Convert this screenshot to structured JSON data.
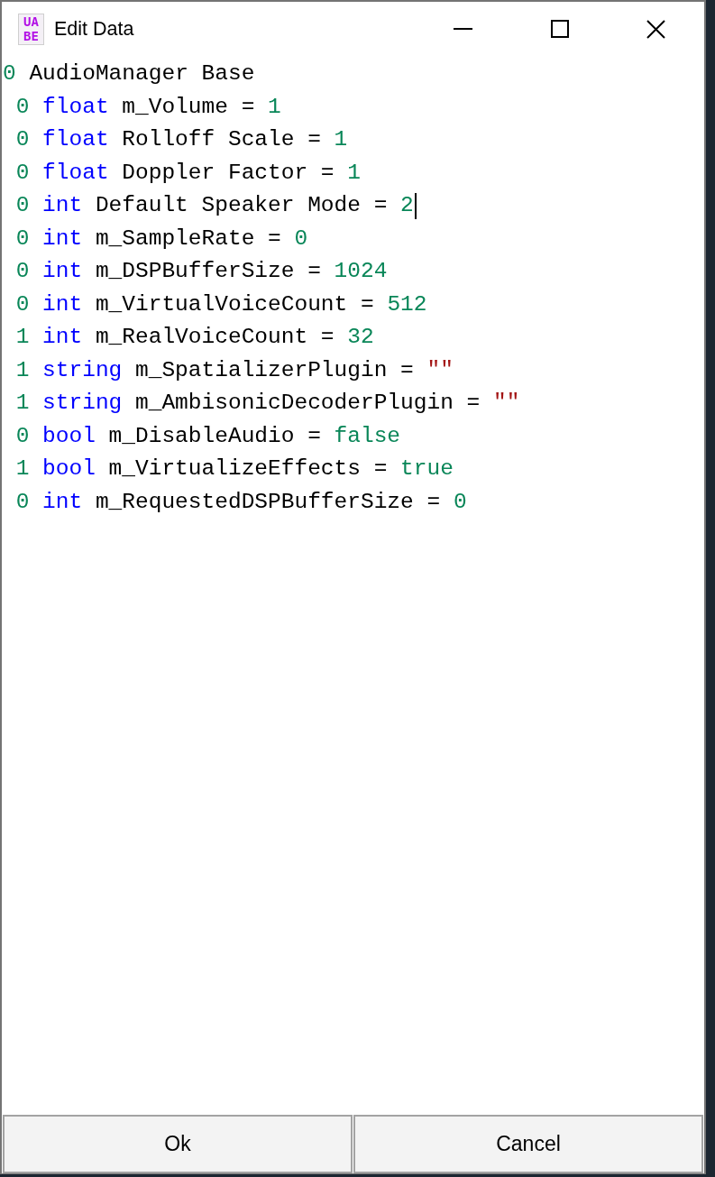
{
  "window": {
    "title": "Edit Data",
    "logo": "UABE"
  },
  "editor": {
    "lines": [
      {
        "flag": "0",
        "name": "AudioManager Base",
        "caret": false,
        "children": [
          {
            "flag": "0",
            "type": "float",
            "name": "m_Volume",
            "operator": "=",
            "value": "1",
            "kind": "number",
            "caret": false
          },
          {
            "flag": "0",
            "type": "float",
            "name": "Rolloff Scale",
            "operator": "=",
            "value": "1",
            "kind": "number",
            "caret": false
          },
          {
            "flag": "0",
            "type": "float",
            "name": "Doppler Factor",
            "operator": "=",
            "value": "1",
            "kind": "number",
            "caret": false
          },
          {
            "flag": "0",
            "type": "int",
            "name": "Default Speaker Mode",
            "operator": "=",
            "value": "2",
            "kind": "number",
            "caret": true
          },
          {
            "flag": "0",
            "type": "int",
            "name": "m_SampleRate",
            "operator": "=",
            "value": "0",
            "kind": "number",
            "caret": false
          },
          {
            "flag": "0",
            "type": "int",
            "name": "m_DSPBufferSize",
            "operator": "=",
            "value": "1024",
            "kind": "number",
            "caret": false
          },
          {
            "flag": "0",
            "type": "int",
            "name": "m_VirtualVoiceCount",
            "operator": "=",
            "value": "512",
            "kind": "number",
            "caret": false
          },
          {
            "flag": "1",
            "type": "int",
            "name": "m_RealVoiceCount",
            "operator": "=",
            "value": "32",
            "kind": "number",
            "caret": false
          },
          {
            "flag": "1",
            "type": "string",
            "name": "m_SpatializerPlugin",
            "operator": "=",
            "value": "\"\"",
            "kind": "string",
            "caret": false
          },
          {
            "flag": "1",
            "type": "string",
            "name": "m_AmbisonicDecoderPlugin",
            "operator": "=",
            "value": "\"\"",
            "kind": "string",
            "caret": false
          },
          {
            "flag": "0",
            "type": "bool",
            "name": "m_DisableAudio",
            "operator": "=",
            "value": "false",
            "kind": "bool",
            "caret": false
          },
          {
            "flag": "1",
            "type": "bool",
            "name": "m_VirtualizeEffects",
            "operator": "=",
            "value": "true",
            "kind": "bool",
            "caret": false
          },
          {
            "flag": "0",
            "type": "int",
            "name": "m_RequestedDSPBufferSize",
            "operator": "=",
            "value": "0",
            "kind": "number",
            "caret": false
          }
        ]
      }
    ]
  },
  "buttons": [
    {
      "label": "Ok"
    },
    {
      "label": "Cancel"
    }
  ]
}
